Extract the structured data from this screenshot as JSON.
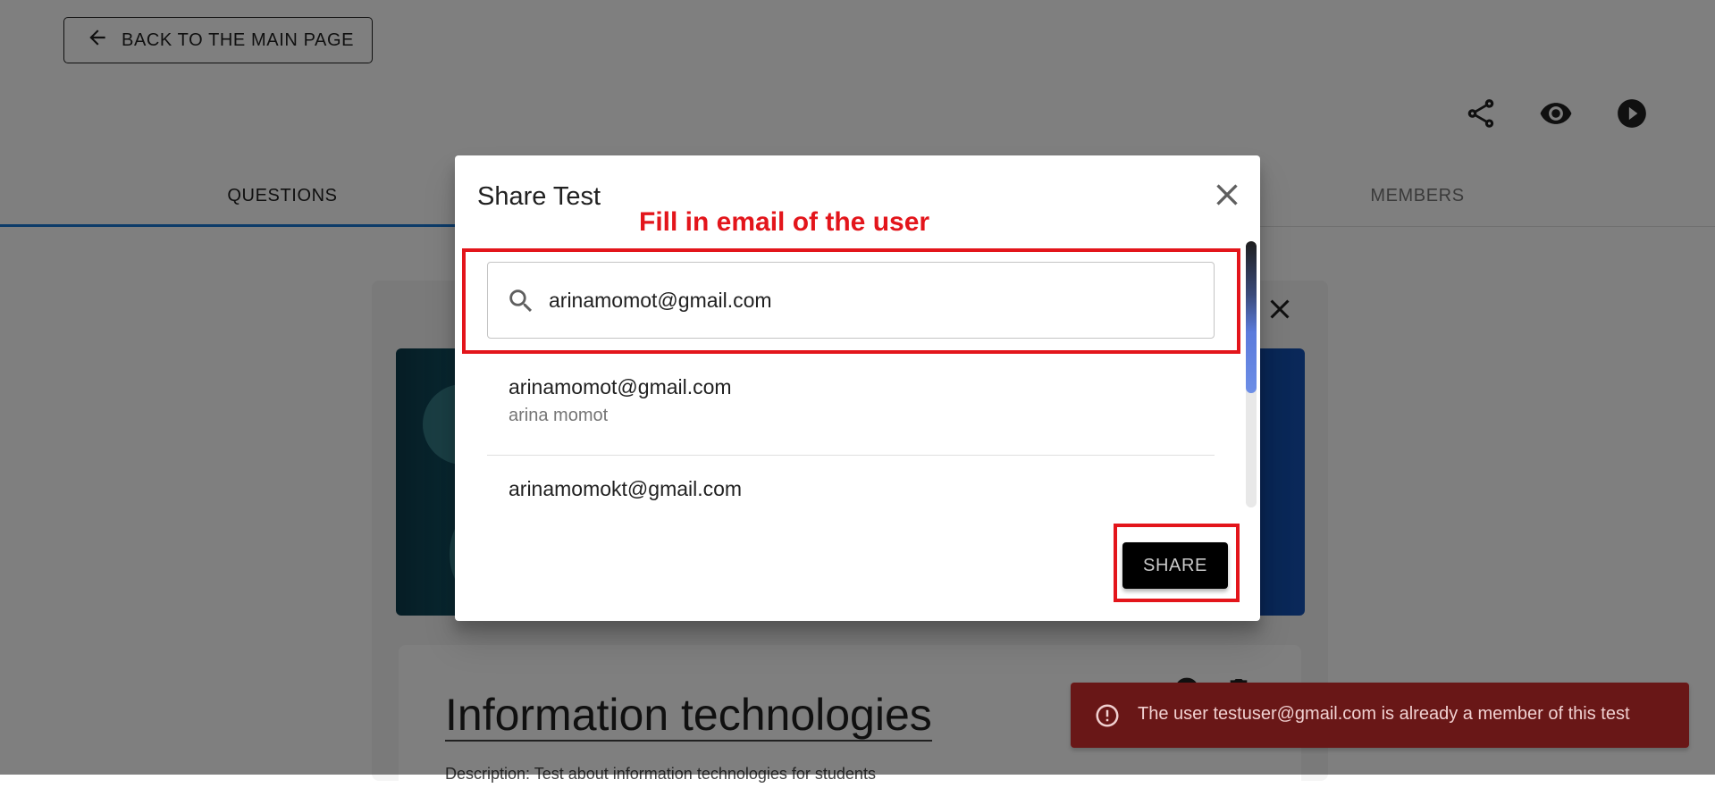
{
  "page": {
    "back_button_label": "BACK TO THE MAIN PAGE",
    "top_icons": [
      "share-icon",
      "eye-icon",
      "play-icon"
    ],
    "tabs": [
      {
        "label": "QUESTIONS",
        "active": true
      },
      {
        "label": "MEMBERS",
        "active": false
      }
    ],
    "test_title": "Information technologies",
    "test_description": "Description:  Test about information technologies for students"
  },
  "dialog": {
    "title": "Share Test",
    "annotation": "Fill in email of the user",
    "search": {
      "icon": "search-icon",
      "value": "arinamomot@gmail.com",
      "placeholder": ""
    },
    "results": [
      {
        "email": "arinamomot@gmail.com",
        "name": "arina momot"
      },
      {
        "email": "arinamomokt@gmail.com",
        "name": ""
      }
    ],
    "share_label": "SHARE",
    "annotation_color": "#e3151b"
  },
  "toast": {
    "icon": "error-icon",
    "message": "The user testuser@gmail.com is already a member of this test",
    "color": "#d32f2f"
  }
}
